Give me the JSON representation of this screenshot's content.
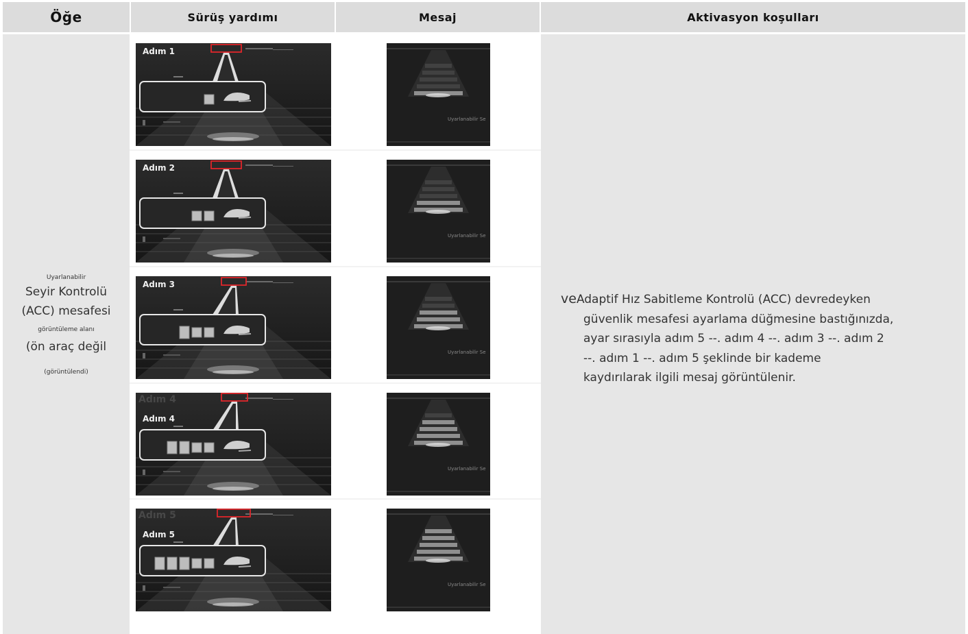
{
  "table": {
    "headers": [
      "Öğe",
      "Sürüş yardımı",
      "Mesaj",
      "Aktivasyon koşulları"
    ],
    "item": {
      "lines": [
        {
          "text": "Uyarlanabilir",
          "size": "sm"
        },
        {
          "text": "Seyir Kontrolü",
          "size": "lg"
        },
        {
          "text": "(ACC) mesafesi",
          "size": "lg"
        },
        {
          "text": "görüntüleme alanı",
          "size": "sm"
        },
        {
          "text": "(ön araç değil",
          "size": "lg"
        },
        {
          "text": "(görüntülendi)",
          "size": "sm"
        }
      ]
    },
    "steps": [
      {
        "label": "Adım 1",
        "cars": 1
      },
      {
        "label": "Adım 2",
        "cars": 2
      },
      {
        "label": "Adım 3",
        "cars": 3
      },
      {
        "label": "Adım 4",
        "cars": 4
      },
      {
        "label": "Adım 5",
        "cars": 5
      }
    ],
    "message_caption": "Uyarlanabilir Se",
    "conditions": {
      "bullet": "ve",
      "lines": [
        "Adaptif Hız Sabitleme Kontrolü (ACC) devredeyken",
        "güvenlik mesafesi ayarlama düğmesine bastığınızda,",
        "ayar sırasıyla adım 5 --. adım 4 --. adım 3 --. adım 2",
        "--. adım 1 --. adım 5 şeklinde bir kademe",
        "kaydırılarak ilgili mesaj görüntülenir."
      ]
    }
  }
}
